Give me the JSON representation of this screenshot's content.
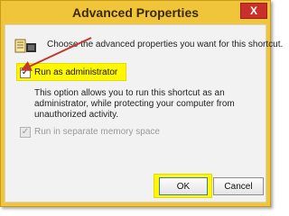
{
  "window": {
    "title": "Advanced Properties",
    "close_label": "X"
  },
  "header": {
    "icon": "shortcut-properties-icon",
    "text": "Choose the advanced properties you want for this shortcut."
  },
  "options": {
    "run_as_admin": {
      "label": "Run as administrator",
      "checked": true,
      "check_glyph": "✓",
      "highlight_color": "#fff800"
    },
    "description": "This option allows you to run this shortcut as an administrator, while protecting your computer from unauthorized activity.",
    "separate_memory": {
      "label": "Run in separate memory space",
      "checked": true,
      "disabled": true,
      "check_glyph": "✓"
    }
  },
  "buttons": {
    "ok": "OK",
    "cancel": "Cancel"
  },
  "annotation": {
    "arrow_color": "#c0392b"
  }
}
